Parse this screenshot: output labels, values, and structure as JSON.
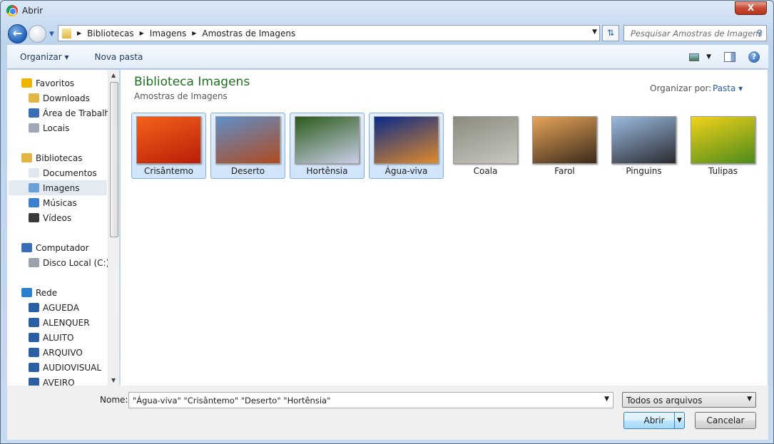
{
  "window": {
    "title": "Abrir",
    "close": "X"
  },
  "address": {
    "crumbs": [
      "Bibliotecas",
      "Imagens",
      "Amostras de Imagens"
    ]
  },
  "search": {
    "placeholder": "Pesquisar Amostras de Imagens"
  },
  "toolbar": {
    "organize": "Organizar ▾",
    "new_folder": "Nova pasta"
  },
  "sidebar": {
    "items": [
      {
        "label": "Favoritos",
        "icon": "star-icon",
        "level": 0
      },
      {
        "label": "Downloads",
        "icon": "downloads-folder-icon",
        "level": 1
      },
      {
        "label": "Área de Trabalho",
        "icon": "desktop-icon",
        "level": 1
      },
      {
        "label": "Locais",
        "icon": "recent-places-icon",
        "level": 1
      },
      {
        "label": "Bibliotecas",
        "icon": "libraries-icon",
        "level": 0
      },
      {
        "label": "Documentos",
        "icon": "documents-icon",
        "level": 1
      },
      {
        "label": "Imagens",
        "icon": "pictures-icon",
        "level": 1,
        "selected": true
      },
      {
        "label": "Músicas",
        "icon": "music-icon",
        "level": 1
      },
      {
        "label": "Vídeos",
        "icon": "videos-icon",
        "level": 1
      },
      {
        "label": "Computador",
        "icon": "computer-icon",
        "level": 0
      },
      {
        "label": "Disco Local (C:)",
        "icon": "drive-icon",
        "level": 1
      },
      {
        "label": "Rede",
        "icon": "network-icon",
        "level": 0
      },
      {
        "label": "AGUEDA",
        "icon": "network-computer-icon",
        "level": 1
      },
      {
        "label": "ALENQUER",
        "icon": "network-computer-icon",
        "level": 1
      },
      {
        "label": "ALUITO",
        "icon": "network-computer-icon",
        "level": 1
      },
      {
        "label": "ARQUIVO",
        "icon": "network-computer-icon",
        "level": 1
      },
      {
        "label": "AUDIOVISUAL",
        "icon": "network-computer-icon",
        "level": 1
      },
      {
        "label": "AVEIRO",
        "icon": "network-computer-icon",
        "level": 1
      }
    ]
  },
  "main": {
    "title": "Biblioteca Imagens",
    "subtitle": "Amostras de Imagens",
    "arrange_label": "Organizar por:",
    "arrange_value": "Pasta ▾",
    "files": [
      {
        "name": "Crisântemo",
        "selected": true,
        "colors": [
          "#f5621a",
          "#b81d08"
        ]
      },
      {
        "name": "Deserto",
        "selected": true,
        "colors": [
          "#5e8fc9",
          "#b04a1e"
        ]
      },
      {
        "name": "Hortênsia",
        "selected": true,
        "colors": [
          "#2c5a1a",
          "#c9cfe8"
        ]
      },
      {
        "name": "Água-viva",
        "selected": true,
        "colors": [
          "#0a2a8a",
          "#e08a2a"
        ]
      },
      {
        "name": "Coala",
        "selected": false,
        "colors": [
          "#8a8a7e",
          "#c8c8c0"
        ]
      },
      {
        "name": "Farol",
        "selected": false,
        "colors": [
          "#e7a45a",
          "#3a2a1a"
        ]
      },
      {
        "name": "Pinguins",
        "selected": false,
        "colors": [
          "#9bbbe0",
          "#2a2a30"
        ]
      },
      {
        "name": "Tulipas",
        "selected": false,
        "colors": [
          "#f2d21a",
          "#4c8a1a"
        ]
      }
    ]
  },
  "footer": {
    "name_label": "Nome:",
    "name_value": "\"Água-viva\" \"Crisântemo\" \"Deserto\" \"Hortênsia\"",
    "filter": "Todos os arquivos",
    "open": "Abrir",
    "cancel": "Cancelar"
  }
}
